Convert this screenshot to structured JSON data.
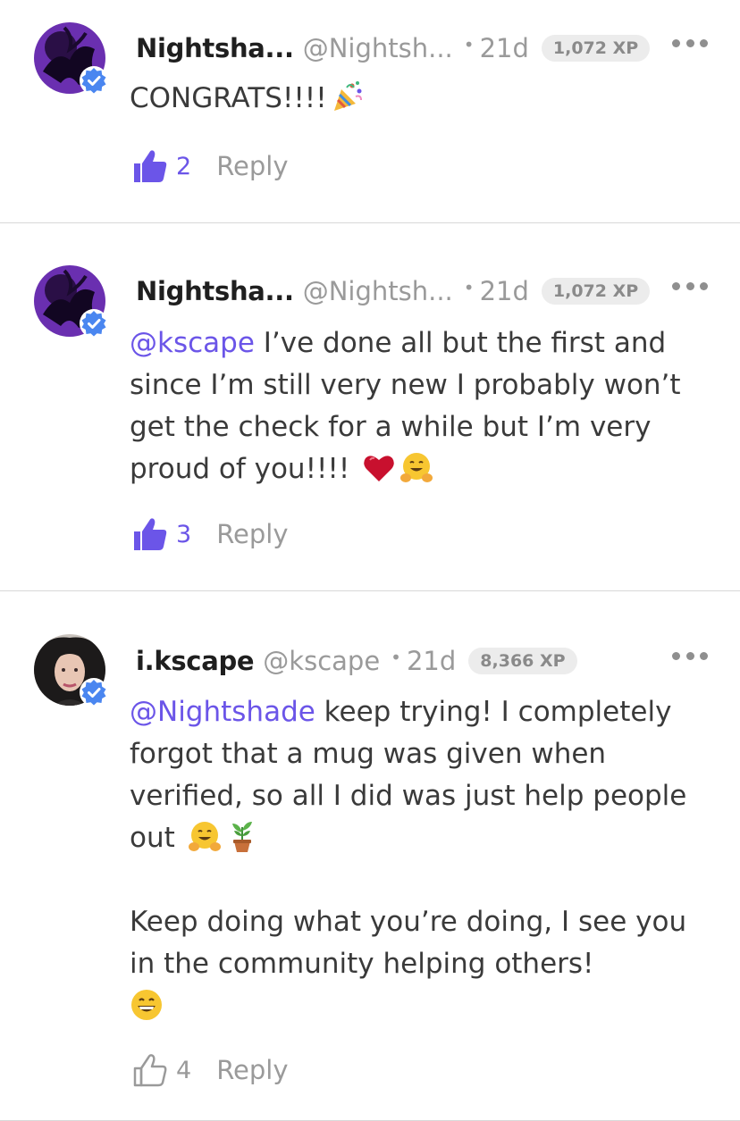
{
  "comments": [
    {
      "name": "Nightsha...",
      "handle": "@Nightsh...",
      "time": "21d",
      "xp": "1,072 XP",
      "mention": "",
      "text": "CONGRATS!!!!",
      "likes": "2",
      "liked": true,
      "reply_label": "Reply",
      "emojis": [
        "party-popper"
      ]
    },
    {
      "name": "Nightsha...",
      "handle": "@Nightsh...",
      "time": "21d",
      "xp": "1,072 XP",
      "mention": "@kscape",
      "text": " I’ve done all but the first and since I’m still very new I probably won’t get the check for a while but I’m very proud of you!!!!",
      "likes": "3",
      "liked": true,
      "reply_label": "Reply",
      "emojis": [
        "red-heart",
        "hugging-face"
      ]
    },
    {
      "name": "i.kscape",
      "handle": "@kscape",
      "time": "21d",
      "xp": "8,366 XP",
      "mention": "@Nightshade",
      "text": " keep trying! I completely forgot that a mug was given when verified, so all I did was just help people out",
      "text2": "Keep doing what you’re doing, I see you in the community helping others!",
      "likes": "4",
      "liked": false,
      "reply_label": "Reply",
      "emojis": [
        "hugging-face",
        "potted-plant",
        "grinning-face"
      ]
    }
  ],
  "colors": {
    "accent": "#6b55e8",
    "muted": "#9a9a9a",
    "verified": "#4a86f0",
    "divider": "#d8d8d8"
  }
}
